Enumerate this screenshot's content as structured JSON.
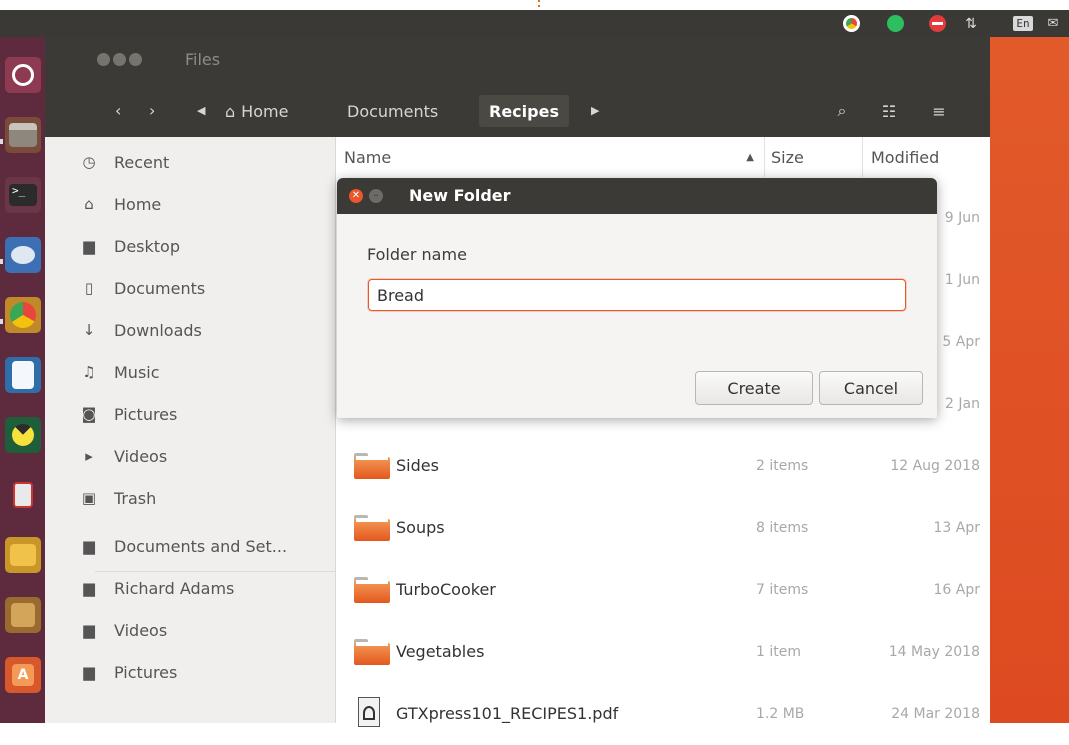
{
  "top_panel": {
    "indicators": [
      "chrome-icon",
      "evernote-icon",
      "no-entry-icon",
      "network-icon"
    ],
    "keyboard_layout": "En"
  },
  "launcher": {
    "apps": [
      "ubuntu-logo-icon",
      "files-icon",
      "terminal-icon",
      "thunderbird-icon",
      "chrome-icon",
      "writer-icon",
      "pacman-icon",
      "robot-icon",
      "archive-icon",
      "dos-icon",
      "software-center-icon"
    ]
  },
  "window": {
    "title": "Files",
    "nav": {
      "back": "‹",
      "forward": "›"
    },
    "path": [
      "Home",
      "Documents",
      "Recipes"
    ],
    "sidebar": [
      {
        "icon": "clock-icon",
        "glyph": "◷",
        "label": "Recent"
      },
      {
        "icon": "home-icon",
        "glyph": "⌂",
        "label": "Home"
      },
      {
        "icon": "folder-icon",
        "glyph": "▆",
        "label": "Desktop"
      },
      {
        "icon": "document-icon",
        "glyph": "▯",
        "label": "Documents"
      },
      {
        "icon": "download-icon",
        "glyph": "↓",
        "label": "Downloads"
      },
      {
        "icon": "music-icon",
        "glyph": "♫",
        "label": "Music"
      },
      {
        "icon": "camera-icon",
        "glyph": "◙",
        "label": "Pictures"
      },
      {
        "icon": "video-icon",
        "glyph": "▸",
        "label": "Videos"
      },
      {
        "icon": "trash-icon",
        "glyph": "▣",
        "label": "Trash"
      },
      {
        "icon": "folder-icon",
        "glyph": "▆",
        "label": "Documents and Set..."
      },
      {
        "icon": "folder-icon",
        "glyph": "▆",
        "label": "Richard Adams"
      },
      {
        "icon": "folder-icon",
        "glyph": "▆",
        "label": "Videos"
      },
      {
        "icon": "folder-icon",
        "glyph": "▆",
        "label": "Pictures"
      }
    ],
    "columns": {
      "name": "Name",
      "size": "Size",
      "modified": "Modified"
    },
    "files": [
      {
        "name": "",
        "size": "",
        "modified": "9 Jun",
        "type": "folder"
      },
      {
        "name": "",
        "size": "",
        "modified": "1 Jun",
        "type": "folder"
      },
      {
        "name": "",
        "size": "",
        "modified": "5 Apr",
        "type": "folder"
      },
      {
        "name": "",
        "size": "",
        "modified": "2 Jan",
        "type": "folder"
      },
      {
        "name": "Sides",
        "size": "2 items",
        "modified": "12 Aug 2018",
        "type": "folder"
      },
      {
        "name": "Soups",
        "size": "8 items",
        "modified": "13 Apr",
        "type": "folder"
      },
      {
        "name": "TurboCooker",
        "size": "7 items",
        "modified": "16 Apr",
        "type": "folder"
      },
      {
        "name": "Vegetables",
        "size": "1 item",
        "modified": "14 May 2018",
        "type": "folder"
      },
      {
        "name": "GTXpress101_RECIPES1.pdf",
        "size": "1.2 MB",
        "modified": "24 Mar 2018",
        "type": "pdf"
      }
    ]
  },
  "dialog": {
    "title": "New Folder",
    "field_label": "Folder name",
    "field_value": "Bread",
    "create_label": "Create",
    "cancel_label": "Cancel"
  },
  "colors": {
    "accent": "#e9572b",
    "titlebar": "#3b3a36",
    "launcher": "#5e2a3d"
  }
}
